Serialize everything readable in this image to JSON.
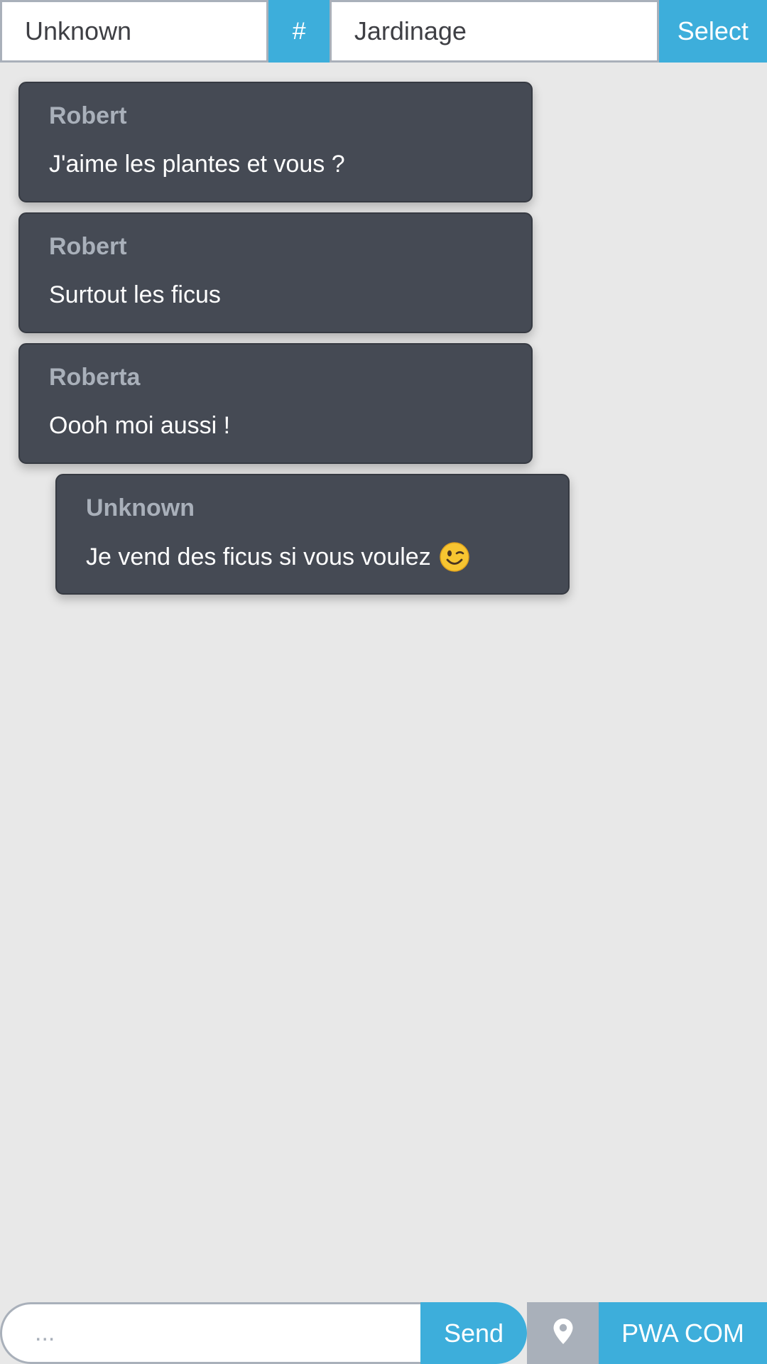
{
  "header": {
    "username_value": "Unknown",
    "hash_label": "#",
    "room_value": "Jardinage",
    "select_label": "Select"
  },
  "messages": [
    {
      "author": "Robert",
      "text": "J'aime les plantes et vous ?"
    },
    {
      "author": "Robert",
      "text": "Surtout les ficus"
    },
    {
      "author": "Roberta",
      "text": "Oooh moi aussi !"
    },
    {
      "author": "Unknown",
      "text": "Je vend des ficus si vous voulez",
      "emoji": "winking-face-icon"
    }
  ],
  "composer": {
    "placeholder": "...",
    "send_label": "Send",
    "location_icon": "location-pin-icon",
    "app_label": "PWA COM"
  },
  "colors": {
    "accent": "#3daedb",
    "bubble": "#454a54",
    "author": "#a9b0ba",
    "background": "#e8e8e8"
  }
}
